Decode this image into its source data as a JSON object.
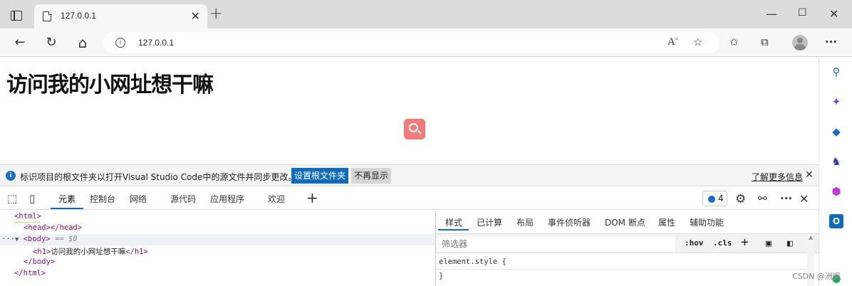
{
  "browser": {
    "tab_title": "127.0.0.1",
    "tab_close": "✕",
    "new_tab": "+",
    "window": {
      "minimize": "—",
      "maximize": "☐",
      "close": "✕"
    },
    "url": "127.0.0.1",
    "nav": {
      "back": "←",
      "refresh": "↻",
      "home": "⌂",
      "more": "···"
    },
    "toolbar_icons": [
      "read-aloud-icon",
      "add-favorite-icon",
      "favorites-icon",
      "collections-icon",
      "profile-icon",
      "more-icon"
    ]
  },
  "page": {
    "heading": "访问我的小网址想干嘛"
  },
  "sidebar": {
    "icons": [
      "search-icon",
      "copilot-icon",
      "shopping-icon",
      "games-icon",
      "office-icon",
      "outlook-icon"
    ],
    "colors": {
      "search": "#1a6fc9",
      "copilot": "#7b3fe4",
      "shopping": "#1a6fc9",
      "games": "#3b3ba0",
      "office": "#c23bd4",
      "outlook": "#0f6cbd"
    }
  },
  "infobar": {
    "message": "标识项目的根文件夹以打开Visual Studio Code中的源文件并同步更改。",
    "primary_button": "设置根文件夹",
    "secondary_button": "不再显示",
    "learn_more": "了解更多信息",
    "close": "✕"
  },
  "devtools": {
    "tabs": [
      "元素",
      "控制台",
      "网络",
      "源代码",
      "应用程序",
      "欢迎"
    ],
    "active_tab": "元素",
    "add_tab": "+",
    "issues_count": "4",
    "dom": {
      "html_open": "<html>",
      "head": "<head></head>",
      "body_open": "<body>",
      "body_eq": "== $0",
      "h1_open": "<h1>",
      "h1_text": "访问我的小网址想干嘛",
      "h1_close": "</h1>",
      "body_close": "</body>",
      "html_close": "</html>",
      "row_prefix": "···",
      "expander": "▼"
    },
    "styles": {
      "tabs": [
        "样式",
        "已计算",
        "布局",
        "事件侦听器",
        "DOM 断点",
        "属性",
        "辅助功能"
      ],
      "active_tab": "样式",
      "filter_placeholder": "筛选器",
      "hov": ":hov",
      "cls": ".cls",
      "plus": "+",
      "rule_selector": "element.style {",
      "rule_close": "}"
    }
  },
  "watermark": "CSDN @洲瞬"
}
